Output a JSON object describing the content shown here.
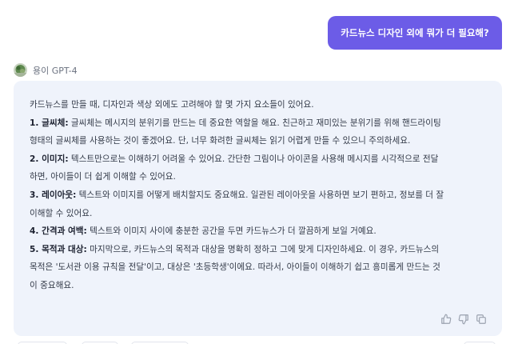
{
  "user_message": "카드뉴스 디자인 외에 뭐가 더 필요해?",
  "assistant": {
    "name": "용이 GPT-4",
    "intro": "카드뉴스를 만들 때, 디자인과 색상 외에도 고려해야 할 몇 가지 요소들이 있어요.",
    "item1_title": "1. 글씨체:",
    "item1_line1": " 글씨체는 메시지의 분위기를 만드는 데 중요한 역할을 해요. 친근하고 재미있는 분위기를 위해 핸드라이팅",
    "item1_line2": "형태의 글씨체를 사용하는 것이 좋겠어요. 단, 너무 화려한 글씨체는 읽기 어렵게 만들 수 있으니 주의하세요.",
    "item2_title": "2. 이미지:",
    "item2_line1": " 텍스트만으로는 이해하기 어려울 수 있어요. 간단한 그림이나 아이콘을 사용해 메시지를 시각적으로 전달",
    "item2_line2": "하면, 아이들이 더 쉽게 이해할 수 있어요.",
    "item3_title": "3. 레이아웃:",
    "item3_line1": " 텍스트와 이미지를 어떻게 배치할지도 중요해요. 일관된 레이아웃을 사용하면 보기 편하고, 정보를 더 잘",
    "item3_line2": "이해할 수 있어요.",
    "item4_title": "4. 간격과 여백:",
    "item4_line1": " 텍스트와 이미지 사이에 충분한 공간을 두면 카드뉴스가 더 깔끔하게 보일 거예요.",
    "item5_title": "5. 목적과 대상:",
    "item5_line1": " 마지막으로, 카드뉴스의 목적과 대상을 명확히 정하고 그에 맞게 디자인하세요. 이 경우, 카드뉴스의",
    "item5_line2": "목적은 '도서관 이용 규칙을 전달'이고, 대상은 '초등학생'이에요. 따라서, 아이들이 이해하기 쉽고 흥미롭게 만드는 것",
    "item5_line3": "이 중요해요."
  },
  "icons": {
    "like": "thumbs-up-icon",
    "dislike": "thumbs-down-icon",
    "copy": "copy-icon",
    "avatar": "avatar-image"
  },
  "colors": {
    "user_bubble": "#6c5ce7",
    "assistant_bubble": "#eff3fb",
    "text": "#333a48",
    "icon": "#9aa1ae"
  }
}
